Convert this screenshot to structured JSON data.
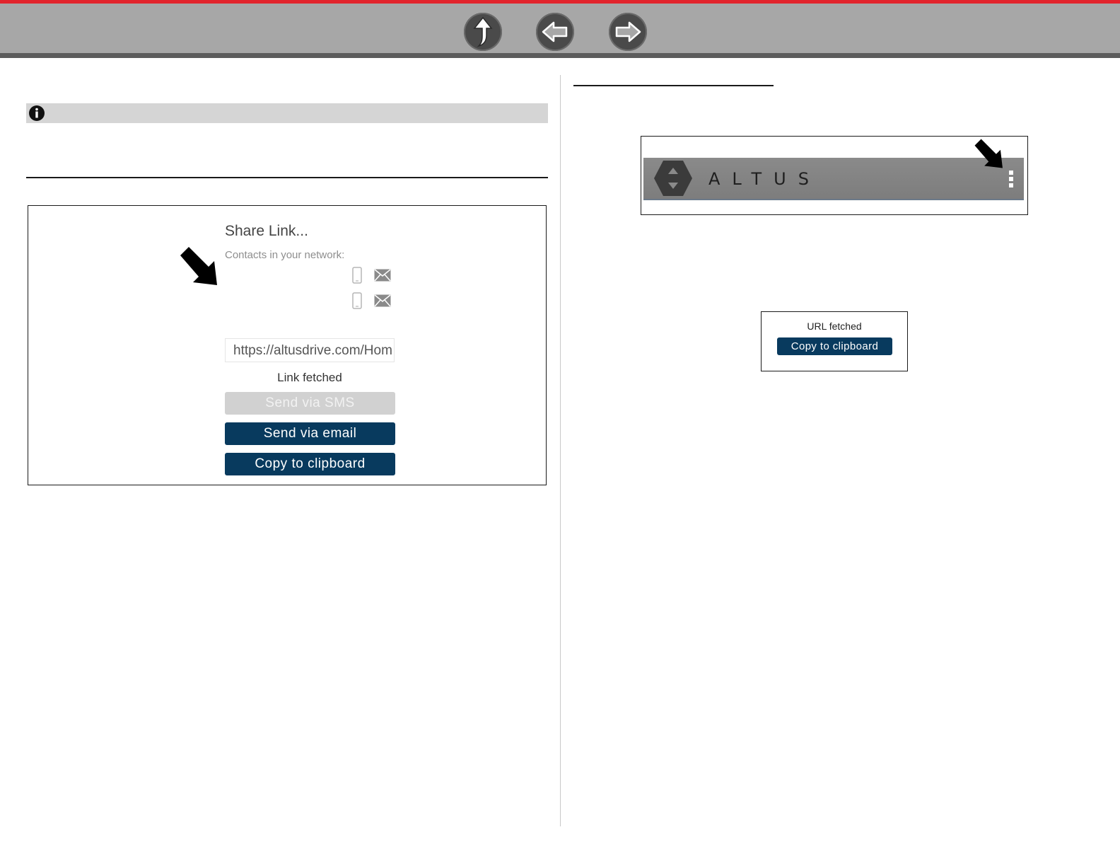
{
  "toolbar": {
    "icons": [
      "home-up-arrow-icon",
      "back-arrow-icon",
      "forward-arrow-icon"
    ],
    "accent_color": "#e2242c"
  },
  "share_dialog": {
    "title": "Share Link...",
    "contacts_label": "Contacts in your network:",
    "url_value": "https://altusdrive.com/Hom",
    "status": "Link fetched",
    "sms_button": "Send via SMS",
    "email_button": "Send via email",
    "clipboard_button": "Copy to clipboard",
    "contact_icons": [
      "phone-icon",
      "mail-icon"
    ]
  },
  "altus_header": {
    "brand": "ALTUS",
    "menu_icon": "kebab-menu-icon"
  },
  "url_popup": {
    "status": "URL fetched",
    "clipboard_button": "Copy to clipboard"
  },
  "colors": {
    "primary_button": "#083a5e",
    "disabled_button": "#d1d1d1",
    "header_gray": "#a7a7a7"
  }
}
